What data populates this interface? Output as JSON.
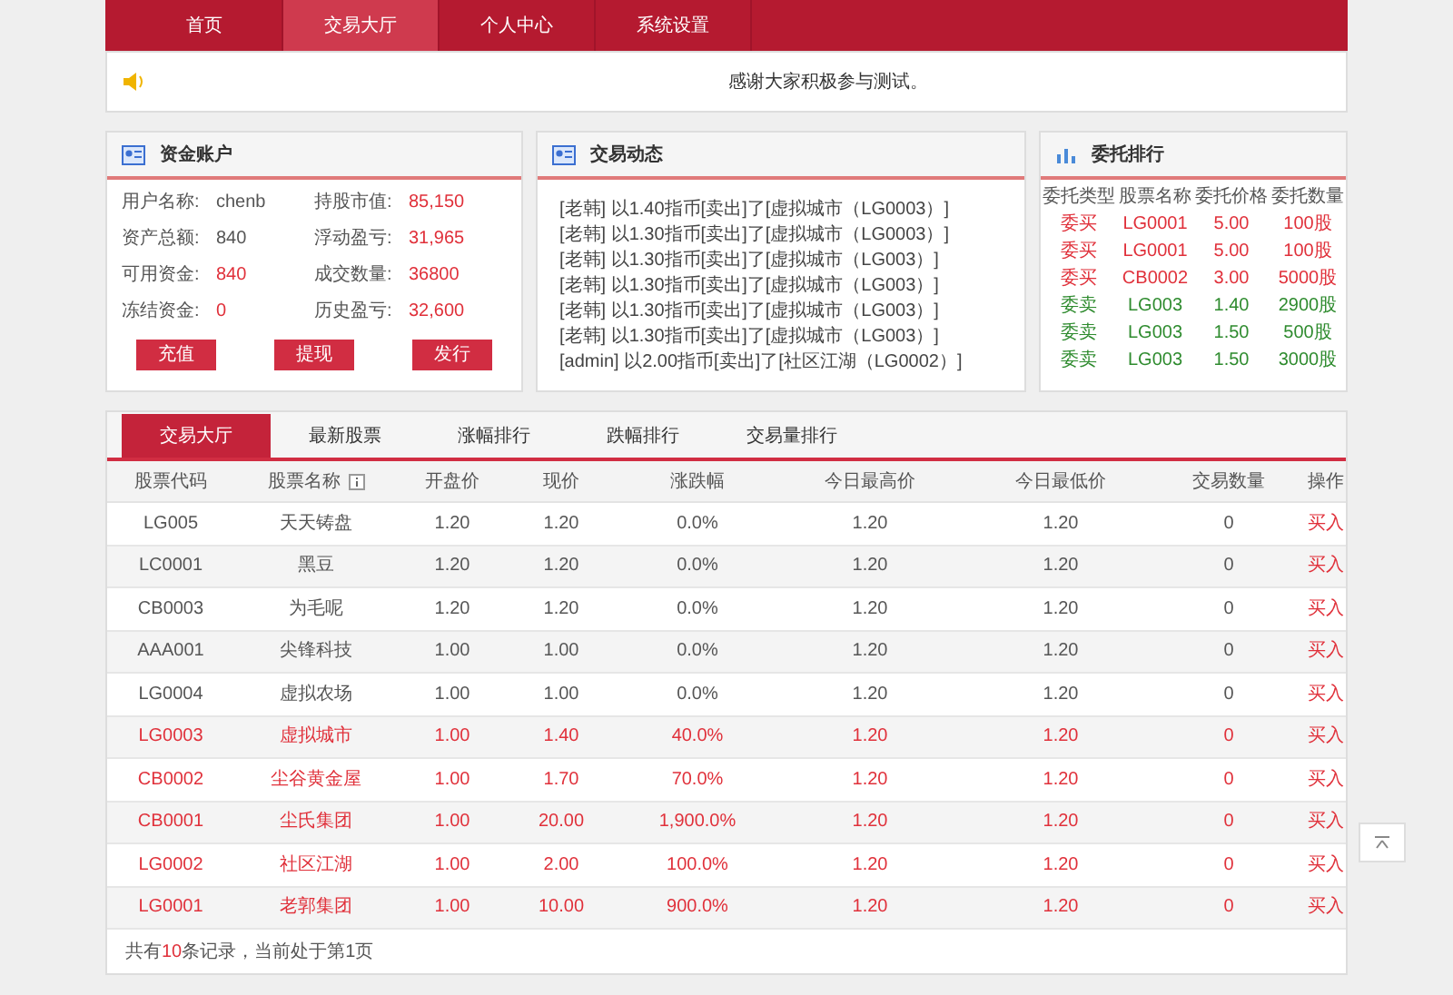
{
  "nav": [
    {
      "label": "首页",
      "selected": false
    },
    {
      "label": "交易大厅",
      "selected": true
    },
    {
      "label": "个人中心",
      "selected": false
    },
    {
      "label": "系统设置",
      "selected": false
    }
  ],
  "notice": "感谢大家积极参与测试。",
  "account": {
    "title": "资金账户",
    "fields": [
      {
        "label": "用户名称:",
        "value": "chenb",
        "highlight": false
      },
      {
        "label": "持股市值:",
        "value": "85,150",
        "highlight": true
      },
      {
        "label": "资产总额:",
        "value": "840",
        "highlight": false
      },
      {
        "label": "浮动盈亏:",
        "value": "31,965",
        "highlight": true
      },
      {
        "label": "可用资金:",
        "value": "840",
        "highlight": true
      },
      {
        "label": "成交数量:",
        "value": "36800",
        "highlight": true
      },
      {
        "label": "冻结资金:",
        "value": "0",
        "highlight": true
      },
      {
        "label": "历史盈亏:",
        "value": "32,600",
        "highlight": true
      }
    ],
    "buttons": [
      "充值",
      "提现",
      "发行"
    ]
  },
  "activity": {
    "title": "交易动态",
    "lines": [
      "[老韩] 以1.40指币[卖出]了[虚拟城市（LG0003）]",
      "[老韩] 以1.30指币[卖出]了[虚拟城市（LG0003）]",
      "[老韩] 以1.30指币[卖出]了[虚拟城市（LG003）]",
      "[老韩] 以1.30指币[卖出]了[虚拟城市（LG003）]",
      "[老韩] 以1.30指币[卖出]了[虚拟城市（LG003）]",
      "[老韩] 以1.30指币[卖出]了[虚拟城市（LG003）]",
      "[admin] 以2.00指币[卖出]了[社区江湖（LG0002）]"
    ]
  },
  "orders": {
    "title": "委托排行",
    "columns": [
      "委托类型",
      "股票名称",
      "委托价格",
      "委托数量"
    ],
    "rows": [
      {
        "kind": "buy",
        "type": "委买",
        "name": "LG0001",
        "price": "5.00",
        "qty": "100股"
      },
      {
        "kind": "buy",
        "type": "委买",
        "name": "LG0001",
        "price": "5.00",
        "qty": "100股"
      },
      {
        "kind": "buy",
        "type": "委买",
        "name": "CB0002",
        "price": "3.00",
        "qty": "5000股"
      },
      {
        "kind": "sell",
        "type": "委卖",
        "name": "LG003",
        "price": "1.40",
        "qty": "2900股"
      },
      {
        "kind": "sell",
        "type": "委卖",
        "name": "LG003",
        "price": "1.50",
        "qty": "500股"
      },
      {
        "kind": "sell",
        "type": "委卖",
        "name": "LG003",
        "price": "1.50",
        "qty": "3000股"
      }
    ]
  },
  "tabs": [
    {
      "label": "交易大厅",
      "selected": true
    },
    {
      "label": "最新股票",
      "selected": false
    },
    {
      "label": "涨幅排行",
      "selected": false
    },
    {
      "label": "跌幅排行",
      "selected": false
    },
    {
      "label": "交易量排行",
      "selected": false
    }
  ],
  "table": {
    "columns": [
      "股票代码",
      "股票名称",
      "开盘价",
      "现价",
      "涨跌幅",
      "今日最高价",
      "今日最低价",
      "交易数量",
      "操作"
    ],
    "rows": [
      {
        "rising": false,
        "cells": [
          "LG005",
          "天天铸盘",
          "1.20",
          "1.20",
          "0.0%",
          "1.20",
          "1.20",
          "0"
        ],
        "action": "买入"
      },
      {
        "rising": false,
        "cells": [
          "LC0001",
          "黑豆",
          "1.20",
          "1.20",
          "0.0%",
          "1.20",
          "1.20",
          "0"
        ],
        "action": "买入"
      },
      {
        "rising": false,
        "cells": [
          "CB0003",
          "为毛呢",
          "1.20",
          "1.20",
          "0.0%",
          "1.20",
          "1.20",
          "0"
        ],
        "action": "买入"
      },
      {
        "rising": false,
        "cells": [
          "AAA001",
          "尖锋科技",
          "1.00",
          "1.00",
          "0.0%",
          "1.20",
          "1.20",
          "0"
        ],
        "action": "买入"
      },
      {
        "rising": false,
        "cells": [
          "LG0004",
          "虚拟农场",
          "1.00",
          "1.00",
          "0.0%",
          "1.20",
          "1.20",
          "0"
        ],
        "action": "买入"
      },
      {
        "rising": true,
        "cells": [
          "LG0003",
          "虚拟城市",
          "1.00",
          "1.40",
          "40.0%",
          "1.20",
          "1.20",
          "0"
        ],
        "action": "买入"
      },
      {
        "rising": true,
        "cells": [
          "CB0002",
          "尘谷黄金屋",
          "1.00",
          "1.70",
          "70.0%",
          "1.20",
          "1.20",
          "0"
        ],
        "action": "买入"
      },
      {
        "rising": true,
        "cells": [
          "CB0001",
          "尘氏集团",
          "1.00",
          "20.00",
          "1,900.0%",
          "1.20",
          "1.20",
          "0"
        ],
        "action": "买入"
      },
      {
        "rising": true,
        "cells": [
          "LG0002",
          "社区江湖",
          "1.00",
          "2.00",
          "100.0%",
          "1.20",
          "1.20",
          "0"
        ],
        "action": "买入"
      },
      {
        "rising": true,
        "cells": [
          "LG0001",
          "老郭集团",
          "1.00",
          "10.00",
          "900.0%",
          "1.20",
          "1.20",
          "0"
        ],
        "action": "买入"
      }
    ],
    "footer": {
      "prefix": "共有",
      "count": "10",
      "suffix": "条记录，当前处于第1页"
    }
  }
}
